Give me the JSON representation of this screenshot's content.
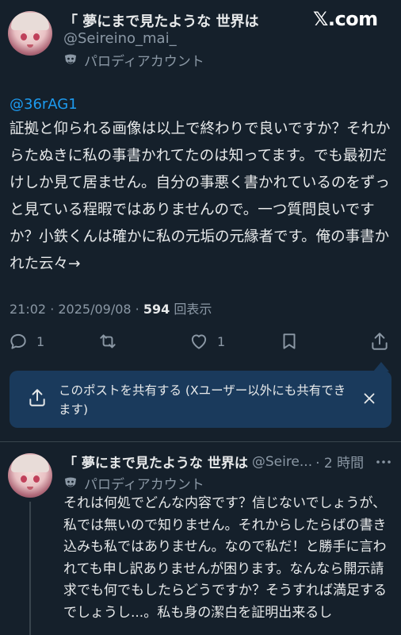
{
  "main_post": {
    "author_name": "「 夢にまで見たような 世界は",
    "author_handle": "@Seireino_mai_",
    "parody_label": "パロディアカウント",
    "mention": "@36rAG1",
    "text": "証拠と仰られる画像は以上で終わりで良いですか？それからたぬきに私の事書かれてたのは知ってます。でも最初だけしか見て居ません。自分の事悪く書かれているのをずっと見ている程暇ではありませんので。一つ質問良いですか？小鉄くんは確かに私の元垢の元縁者です。俺の事書かれた云々→",
    "timestamp": "21:02 · 2025/09/08 · ",
    "views_count": "594",
    "views_label": " 回表示",
    "reply_count": "1",
    "like_count": "1"
  },
  "brand": {
    "logo_text": "𝕏.com"
  },
  "share_prompt": {
    "text": "このポストを共有する (Xユーザー以外にも共有できます)"
  },
  "reply_post": {
    "author_name": "「 夢にまで見たような 世界は",
    "author_handle": "@Seire...",
    "time_ago": "· 2 時間",
    "parody_label": "パロディアカウント",
    "text": "それは何処でどんな内容です？信じないでしょうが、私では無いので知りません。それからしたらばの書き込みも私ではありません。なので私だ！と勝手に言われても申し訳ありませんが困ります。なんなら開示請求でも何でもしたらどうですか？そうすれば満足するでしょうし...。私も身の潔白を証明出来るし"
  },
  "colors": {
    "background": "#15202b",
    "text": "#e7e9ea",
    "secondary": "#8b98a5",
    "accent": "#1d9bf0",
    "share_box": "#1a3a5c"
  }
}
